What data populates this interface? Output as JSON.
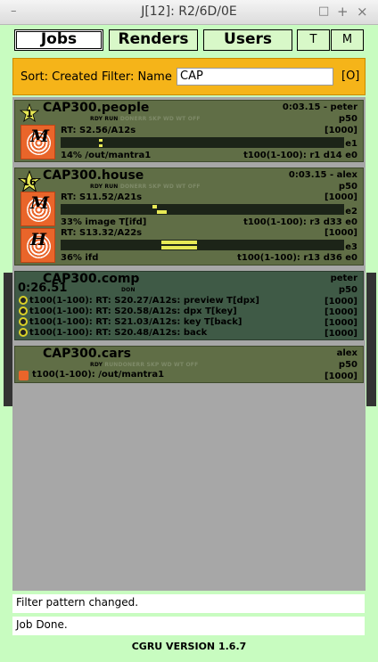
{
  "window": {
    "title": "J[12]: R2/6D/0E",
    "controls": [
      "–",
      "□",
      "+",
      "×"
    ]
  },
  "tabs": {
    "jobs": "Jobs",
    "renders": "Renders",
    "users": "Users",
    "t": "T",
    "m": "M",
    "active": "jobs"
  },
  "filter": {
    "sort_label": "Sort: Created",
    "filter_label": "Filter: Name",
    "value": "CAP",
    "button": "[O]"
  },
  "colors": {
    "accent": "#f5b419",
    "background": "#c8fcc0",
    "job_bg": "#606e46",
    "done_bg": "#3f5a46",
    "progress": "#e8ea56"
  },
  "jobs": [
    {
      "name": "CAP300.people",
      "priority_badge": "1",
      "time_user": "0:03.15 - peter",
      "priority": "p50",
      "states": [
        [
          "RDY",
          true
        ],
        [
          "RUN",
          true
        ],
        [
          "DON",
          false
        ],
        [
          "ERR",
          false
        ],
        [
          "SKP",
          false
        ],
        [
          "WD",
          false
        ],
        [
          "WT",
          false
        ],
        [
          "OFF",
          false
        ]
      ],
      "blocks": [
        {
          "service": "M",
          "rt": "RT: S2.56/A12s",
          "capacity": "[1000]",
          "errors": "e1",
          "info": "14% /out/mantra1",
          "tasks": "t100(1-100): r1 d14 e0",
          "progress": 0.14
        }
      ]
    },
    {
      "name": "CAP300.house",
      "priority_badge": "16",
      "time_user": "0:03.15 - alex",
      "priority": "p50",
      "states": [
        [
          "RDY",
          true
        ],
        [
          "RUN",
          true
        ],
        [
          "DON",
          false
        ],
        [
          "ERR",
          false
        ],
        [
          "SKP",
          false
        ],
        [
          "WD",
          false
        ],
        [
          "WT",
          false
        ],
        [
          "OFF",
          false
        ]
      ],
      "blocks": [
        {
          "service": "M",
          "rt": "RT: S11.52/A21s",
          "capacity": "[1000]",
          "errors": "e2",
          "info": "33% image T[ifd]",
          "tasks": "t100(1-100): r3 d33 e0",
          "progress": 0.33
        },
        {
          "service": "H",
          "rt": "RT: S13.32/A22s",
          "capacity": "[1000]",
          "errors": "e3",
          "info": "36% ifd",
          "tasks": "t100(1-100): r13 d36 e0",
          "progress": 0.36
        }
      ]
    },
    {
      "name": "CAP300.comp",
      "time": "0:26.51",
      "user": "peter",
      "priority": "p50",
      "states": [
        [
          "DON",
          true
        ]
      ],
      "tasks": [
        {
          "text": "t100(1-100): RT: S20.27/A12s: preview T[dpx]",
          "capacity": "[1000]"
        },
        {
          "text": "t100(1-100): RT: S20.58/A12s: dpx T[key]",
          "capacity": "[1000]"
        },
        {
          "text": "t100(1-100): RT: S21.03/A12s: key T[back]",
          "capacity": "[1000]"
        },
        {
          "text": "t100(1-100): RT: S20.48/A12s: back",
          "capacity": "[1000]"
        }
      ]
    },
    {
      "name": "CAP300.cars",
      "user": "alex",
      "priority": "p50",
      "states": [
        [
          "RDY",
          true
        ],
        [
          "RUN",
          false
        ],
        [
          "DON",
          false
        ],
        [
          "ERR",
          false
        ],
        [
          "SKP",
          false
        ],
        [
          "WD",
          false
        ],
        [
          "WT",
          false
        ],
        [
          "OFF",
          false
        ]
      ],
      "tasks": [
        {
          "text": "t100(1-100): /out/mantra1",
          "capacity": "[1000]"
        }
      ]
    }
  ],
  "status": {
    "line1": "Filter pattern changed.",
    "line2": "Job Done."
  },
  "version": "CGRU VERSION 1.6.7"
}
